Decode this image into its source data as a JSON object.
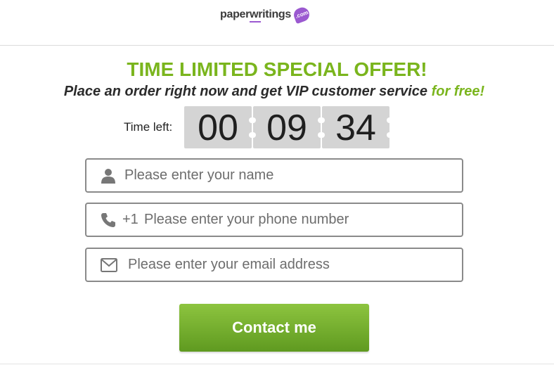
{
  "header": {
    "logo_text": "paperwritings",
    "logo_badge": ".com"
  },
  "offer": {
    "title": "TIME LIMITED SPECIAL OFFER!",
    "subtitle_main": "Place an order right now and get VIP customer service ",
    "subtitle_highlight": "for free!"
  },
  "timer": {
    "label": "Time left:",
    "hours": "00",
    "minutes": "09",
    "seconds": "34"
  },
  "form": {
    "name_placeholder": "Please enter your name",
    "phone_prefix": "+1",
    "phone_placeholder": "Please enter your phone number",
    "email_placeholder": "Please enter your email address",
    "submit_label": "Contact me"
  },
  "colors": {
    "accent_green": "#7ab51d",
    "brand_purple": "#9b59d0",
    "button_top": "#8dc43f",
    "button_bottom": "#5f9a20"
  },
  "icons": {
    "name": "user-icon",
    "phone": "phone-icon",
    "email": "envelope-icon"
  }
}
